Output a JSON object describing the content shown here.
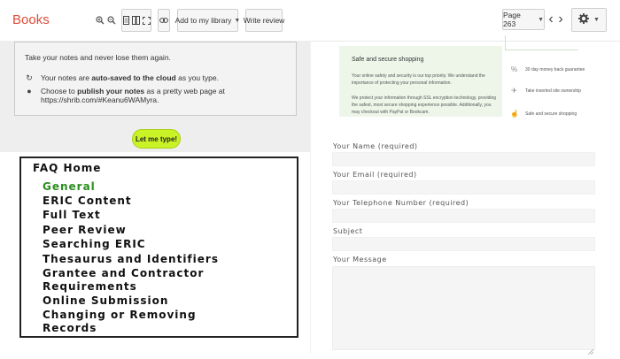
{
  "toolbar": {
    "brand": "Books",
    "zoom_in_icon": "zoom-in-icon",
    "zoom_out_icon": "zoom-out-icon",
    "add_library_label": "Add to my library",
    "write_review_label": "Write review",
    "page_label": "Page 263",
    "settings_icon": "gear-icon"
  },
  "notes": {
    "heading": "Take your notes and never lose them again.",
    "row1_prefix": "Your notes are ",
    "row1_bold": "auto-saved to the cloud",
    "row1_suffix": " as you type.",
    "row2_prefix": "Choose to ",
    "row2_bold": "publish your notes",
    "row2_suffix": " as a pretty web page at",
    "row2_url": "https://shrib.com/#Keanu6WAMyra.",
    "button_label": "Let me type!",
    "button_color": "#c9f227"
  },
  "faq": {
    "title": "FAQ Home",
    "items": [
      "General",
      "ERIC Content",
      "Full Text",
      "Peer Review",
      "Searching ERIC",
      "Thesaurus and Identifiers",
      "Grantee and Contractor",
      "Requirements",
      "Online Submission",
      "Changing or Removing",
      "Records"
    ],
    "active_color": "#2a8f1e"
  },
  "security": {
    "title": "Safe and secure shopping",
    "p1": "Your online safety and security is our top priority. We understand the importance of protecting your personal information.",
    "p2": "We protect your information through SSL encryption technology, providing the safest, most secure shopping experience possible. Additionally, you may checkout with PayPal or Bookcam.",
    "features": [
      "30 day money back guarantee",
      "Take inserted site ownership",
      "Safe and secure shopping"
    ]
  },
  "form": {
    "name_label": "Your Name (required)",
    "email_label": "Your Email (required)",
    "phone_label": "Your Telephone Number (required)",
    "subject_label": "Subject",
    "message_label": "Your Message"
  }
}
